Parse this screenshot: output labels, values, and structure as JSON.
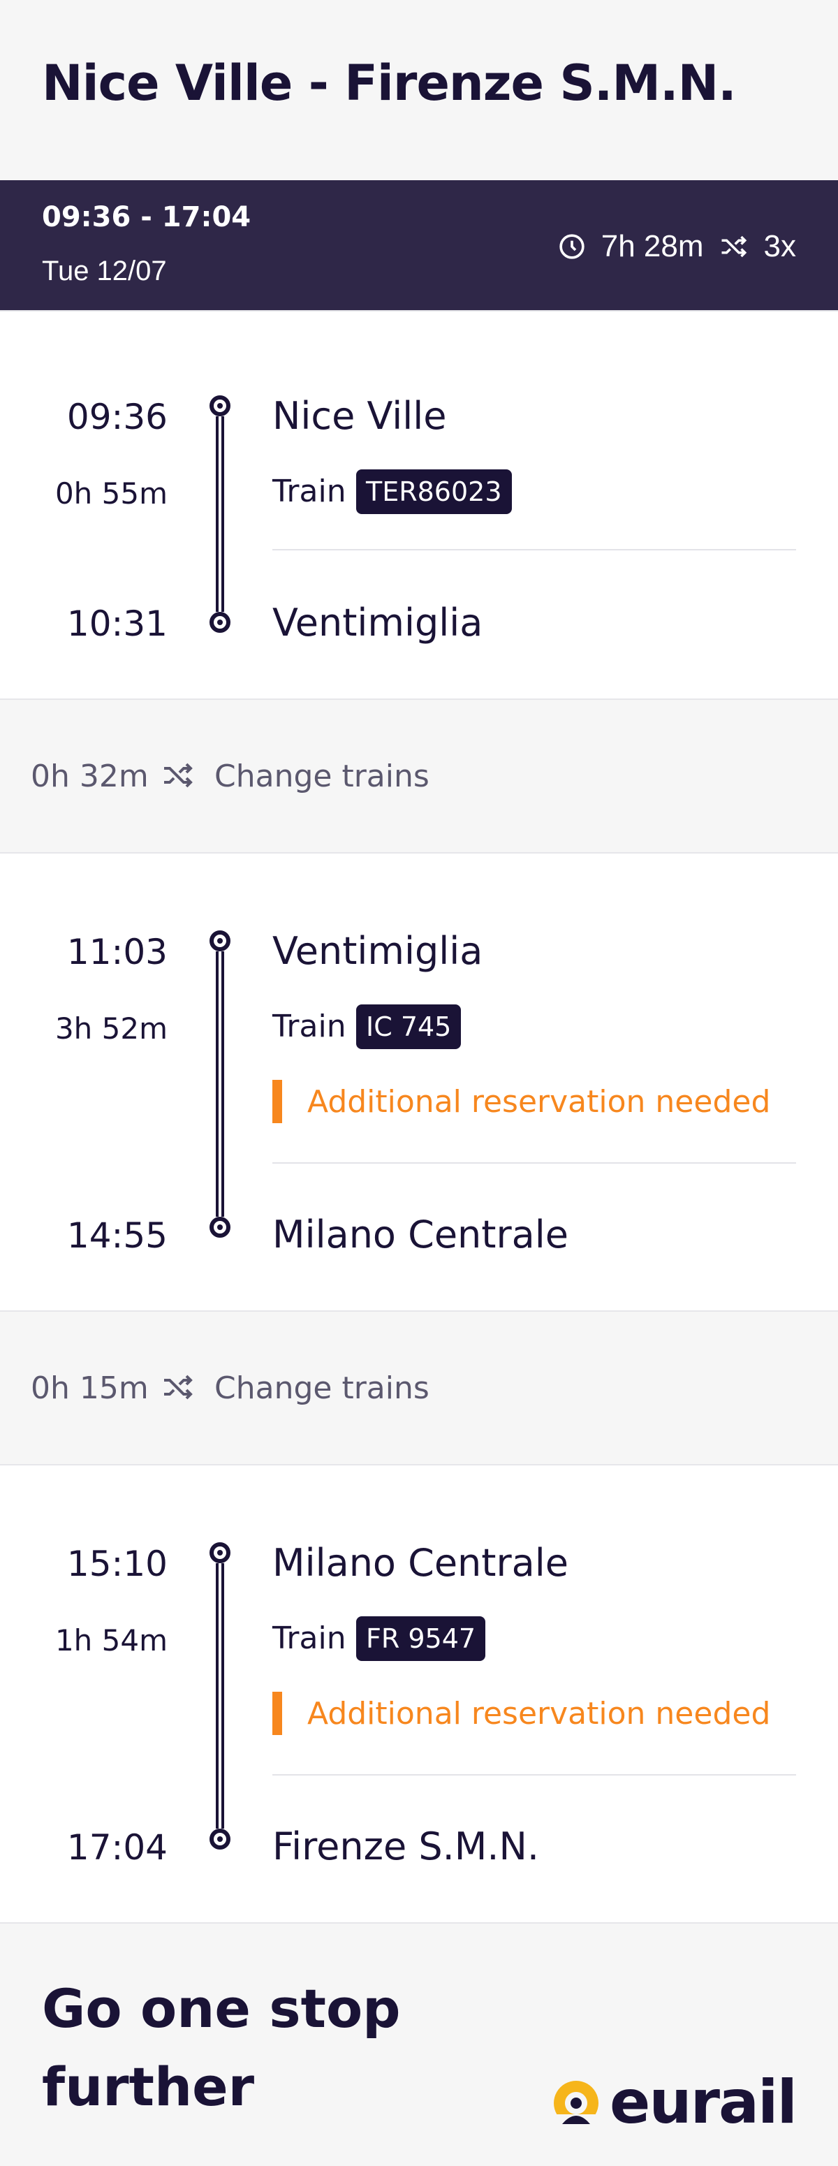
{
  "route": {
    "title": "Nice Ville - Firenze S.M.N."
  },
  "summary": {
    "times": "09:36 - 17:04",
    "date": "Tue 12/07",
    "duration": "7h 28m",
    "changes": "3x"
  },
  "legs": [
    {
      "dep_time": "09:36",
      "dep_station": "Nice Ville",
      "duration": "0h 55m",
      "mode": "Train",
      "train": "TER86023",
      "arr_time": "10:31",
      "arr_station": "Ventimiglia"
    },
    {
      "dep_time": "11:03",
      "dep_station": "Ventimiglia",
      "duration": "3h 52m",
      "mode": "Train",
      "train": "IC 745",
      "note": "Additional reservation needed",
      "arr_time": "14:55",
      "arr_station": "Milano Centrale"
    },
    {
      "dep_time": "15:10",
      "dep_station": "Milano Centrale",
      "duration": "1h 54m",
      "mode": "Train",
      "train": "FR 9547",
      "note": "Additional reservation needed",
      "arr_time": "17:04",
      "arr_station": "Firenze S.M.N."
    }
  ],
  "changes": [
    {
      "duration": "0h 32m",
      "label": "Change trains"
    },
    {
      "duration": "0h 15m",
      "label": "Change trains"
    }
  ],
  "footer": {
    "promo": "Go one stop further",
    "brand": "eurail"
  },
  "colors": {
    "navy": "#1a1336",
    "summary_bg": "#2f2748",
    "warning": "#f7871e"
  },
  "icons": [
    "clock-icon",
    "shuffle-icon",
    "eurail-logo-icon"
  ]
}
